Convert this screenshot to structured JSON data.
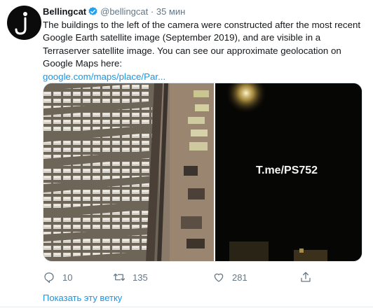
{
  "tweet": {
    "author_name": "Bellingcat",
    "handle": "@bellingcat",
    "separator": "·",
    "time": "35 мин",
    "text": "The buildings to the left of the camera were constructed after the most recent Google Earth satellite image (September 2019), and are visible in a Terraserver satellite image. You can see our approximate geolocation on Google Maps here:",
    "link": "google.com/maps/place/Par...",
    "media": {
      "overlay_text": "T.me/PS752"
    },
    "actions": {
      "replies": "10",
      "retweets": "135",
      "likes": "281"
    },
    "show_thread": "Показать эту ветку"
  },
  "colors": {
    "link": "#1b95e0",
    "verified": "#1da1f2",
    "muted": "#657786"
  },
  "icons": [
    "bellingcat-logo-icon",
    "verified-badge-icon",
    "reply-icon",
    "retweet-icon",
    "like-icon",
    "share-icon"
  ]
}
